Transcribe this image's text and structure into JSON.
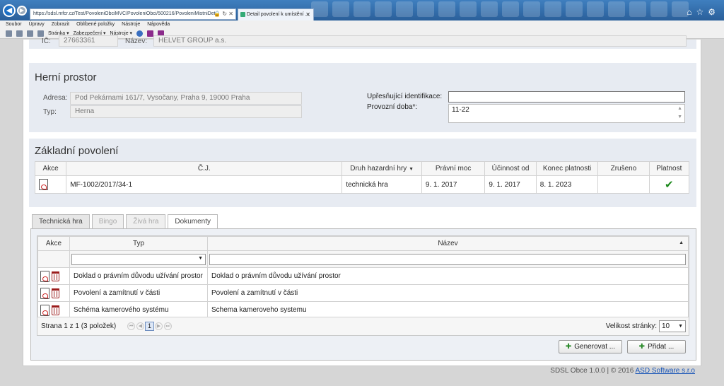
{
  "browser": {
    "address": "https://sdsl.mfcr.cz/Test/PovoleniObciMVC/PovoleniObci/500216/PovoleniMistniDet",
    "tab_title": "Detail povolení k umístění ...",
    "menu": [
      "Soubor",
      "Úpravy",
      "Zobrazit",
      "Oblíbené položky",
      "Nástroje",
      "Nápověda"
    ],
    "commands": [
      "Stránka ▾",
      "Zabezpečení ▾",
      "Nástroje ▾"
    ]
  },
  "operator": {
    "ic_label": "IČ:",
    "ic_value": "27663361",
    "name_label": "Název:",
    "name_value": "HELVET GROUP a.s."
  },
  "venue": {
    "title": "Herní prostor",
    "address_label": "Adresa:",
    "address_value": "Pod Pekárnami 161/7, Vysočany, Praha 9, 19000 Praha",
    "type_label": "Typ:",
    "type_value": "Herna",
    "ident_label": "Upřesňující identifikace:",
    "ident_value": "",
    "hours_label": "Provozní doba*:",
    "hours_value": "11-22"
  },
  "permit": {
    "title": "Základní povolení",
    "headers": [
      "Akce",
      "Č.J.",
      "Druh hazardní hry",
      "Právní moc",
      "Účinnost od",
      "Konec platnosti",
      "Zrušeno",
      "Platnost"
    ],
    "row": {
      "cj": "MF-1002/2017/34-1",
      "druh": "technická hra",
      "pravni_moc": "9. 1. 2017",
      "ucinnost": "9. 1. 2017",
      "konec": "8. 1. 2023",
      "zruseno": "",
      "platnost_icon": "checkmark-icon"
    }
  },
  "tabs": [
    "Technická hra",
    "Bingo",
    "Živá hra",
    "Dokumenty"
  ],
  "documents": {
    "headers": [
      "Akce",
      "Typ",
      "Název"
    ],
    "rows": [
      {
        "typ": "Doklad o právním důvodu užívání prostor",
        "nazev": "Doklad o právním důvodu užívání prostor"
      },
      {
        "typ": "Povolení a zamítnutí v části",
        "nazev": "Povolení a zamítnutí v části"
      },
      {
        "typ": "Schéma kamerového systému",
        "nazev": "Schema kameroveho systemu"
      }
    ],
    "pager_text": "Strana 1 z 1 (3 položek)",
    "current_page": "1",
    "page_size_label": "Velikost stránky:",
    "page_size": "10"
  },
  "buttons": {
    "generate": "Generovat ...",
    "add": "Přidat ..."
  },
  "footer": {
    "version": "SDSL Obce 1.0.0  |  © 2016",
    "company": "ASD Software s.r.o"
  },
  "colors": {
    "panel": "#e7ebf2",
    "accent": "#1b6fc4",
    "check": "#1e8a1e"
  }
}
